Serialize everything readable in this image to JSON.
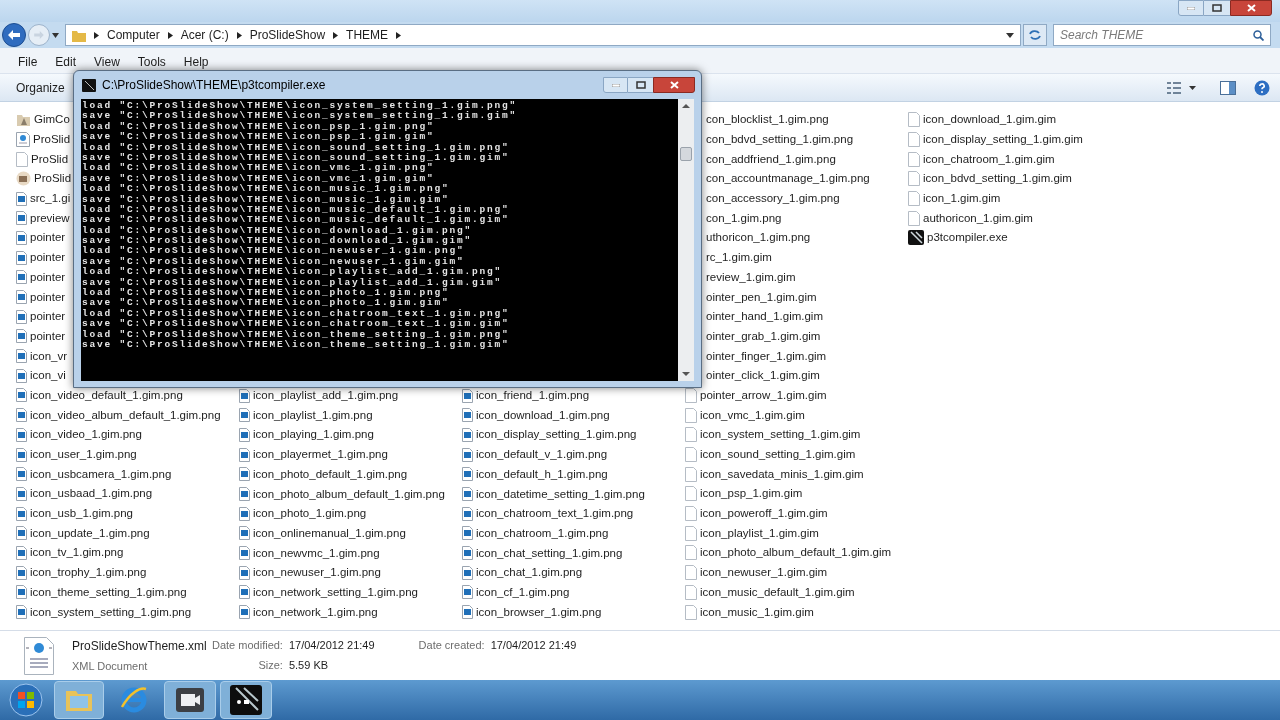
{
  "address_bar": {
    "crumbs": [
      "Computer",
      "Acer (C:)",
      "ProSlideShow",
      "THEME"
    ],
    "search": {
      "placeholder": "Search THEME"
    }
  },
  "menu": [
    "File",
    "Edit",
    "View",
    "Tools",
    "Help"
  ],
  "toolbar": {
    "organize": "Organize"
  },
  "file_columns": [
    {
      "under_window": false,
      "files": [
        {
          "name": "GimCo",
          "kind": "folder"
        },
        {
          "name": "ProSlid",
          "kind": "xml"
        },
        {
          "name": "ProSlid",
          "kind": "file"
        },
        {
          "name": "ProSlid",
          "kind": "app"
        },
        {
          "name": "src_1.gi",
          "kind": "png"
        },
        {
          "name": "preview",
          "kind": "png"
        },
        {
          "name": "pointer",
          "kind": "png"
        },
        {
          "name": "pointer",
          "kind": "png"
        },
        {
          "name": "pointer",
          "kind": "png"
        },
        {
          "name": "pointer",
          "kind": "png"
        },
        {
          "name": "pointer",
          "kind": "png"
        },
        {
          "name": "pointer",
          "kind": "png"
        },
        {
          "name": "icon_vr",
          "kind": "png"
        },
        {
          "name": "icon_vi",
          "kind": "png"
        },
        {
          "name": "icon_video_default_1.gim.png",
          "kind": "png"
        },
        {
          "name": "icon_video_album_default_1.gim.png",
          "kind": "png"
        },
        {
          "name": "icon_video_1.gim.png",
          "kind": "png"
        },
        {
          "name": "icon_user_1.gim.png",
          "kind": "png"
        },
        {
          "name": "icon_usbcamera_1.gim.png",
          "kind": "png"
        },
        {
          "name": "icon_usbaad_1.gim.png",
          "kind": "png"
        },
        {
          "name": "icon_usb_1.gim.png",
          "kind": "png"
        },
        {
          "name": "icon_update_1.gim.png",
          "kind": "png"
        },
        {
          "name": "icon_tv_1.gim.png",
          "kind": "png"
        },
        {
          "name": "icon_trophy_1.gim.png",
          "kind": "png"
        },
        {
          "name": "icon_theme_setting_1.gim.png",
          "kind": "png"
        },
        {
          "name": "icon_system_setting_1.gim.png",
          "kind": "png"
        }
      ]
    },
    {
      "under_window": true,
      "files": [
        {
          "name": "icon_playlist_add_1.gim.png",
          "kind": "png"
        },
        {
          "name": "icon_playlist_1.gim.png",
          "kind": "png"
        },
        {
          "name": "icon_playing_1.gim.png",
          "kind": "png"
        },
        {
          "name": "icon_playermet_1.gim.png",
          "kind": "png"
        },
        {
          "name": "icon_photo_default_1.gim.png",
          "kind": "png"
        },
        {
          "name": "icon_photo_album_default_1.gim.png",
          "kind": "png"
        },
        {
          "name": "icon_photo_1.gim.png",
          "kind": "png"
        },
        {
          "name": "icon_onlinemanual_1.gim.png",
          "kind": "png"
        },
        {
          "name": "icon_newvmc_1.gim.png",
          "kind": "png"
        },
        {
          "name": "icon_newuser_1.gim.png",
          "kind": "png"
        },
        {
          "name": "icon_network_setting_1.gim.png",
          "kind": "png"
        },
        {
          "name": "icon_network_1.gim.png",
          "kind": "png"
        }
      ]
    },
    {
      "under_window": true,
      "files": [
        {
          "name": "icon_friend_1.gim.png",
          "kind": "png"
        },
        {
          "name": "icon_download_1.gim.png",
          "kind": "png"
        },
        {
          "name": "icon_display_setting_1.gim.png",
          "kind": "png"
        },
        {
          "name": "icon_default_v_1.gim.png",
          "kind": "png"
        },
        {
          "name": "icon_default_h_1.gim.png",
          "kind": "png"
        },
        {
          "name": "icon_datetime_setting_1.gim.png",
          "kind": "png"
        },
        {
          "name": "icon_chatroom_text_1.gim.png",
          "kind": "png"
        },
        {
          "name": "icon_chatroom_1.gim.png",
          "kind": "png"
        },
        {
          "name": "icon_chat_setting_1.gim.png",
          "kind": "png"
        },
        {
          "name": "icon_chat_1.gim.png",
          "kind": "png"
        },
        {
          "name": "icon_cf_1.gim.png",
          "kind": "png"
        },
        {
          "name": "icon_browser_1.gim.png",
          "kind": "png"
        }
      ]
    },
    {
      "under_window": false,
      "files": [
        {
          "name": "con_blocklist_1.gim.png"
        },
        {
          "name": "con_bdvd_setting_1.gim.png"
        },
        {
          "name": "con_addfriend_1.gim.png"
        },
        {
          "name": "con_accountmanage_1.gim.png"
        },
        {
          "name": "con_accessory_1.gim.png"
        },
        {
          "name": "con_1.gim.png"
        },
        {
          "name": "uthoricon_1.gim.png"
        },
        {
          "name": "rc_1.gim.gim"
        },
        {
          "name": "review_1.gim.gim"
        },
        {
          "name": "ointer_pen_1.gim.gim"
        },
        {
          "name": "ointer_hand_1.gim.gim"
        },
        {
          "name": "ointer_grab_1.gim.gim"
        },
        {
          "name": "ointer_finger_1.gim.gim"
        },
        {
          "name": "ointer_click_1.gim.gim"
        },
        {
          "name": "pointer_arrow_1.gim.gim",
          "kind": "gim"
        },
        {
          "name": "icon_vmc_1.gim.gim",
          "kind": "gim"
        },
        {
          "name": "icon_system_setting_1.gim.gim",
          "kind": "gim"
        },
        {
          "name": "icon_sound_setting_1.gim.gim",
          "kind": "gim"
        },
        {
          "name": "icon_savedata_minis_1.gim.gim",
          "kind": "gim"
        },
        {
          "name": "icon_psp_1.gim.gim",
          "kind": "gim"
        },
        {
          "name": "icon_poweroff_1.gim.gim",
          "kind": "gim"
        },
        {
          "name": "icon_playlist_1.gim.gim",
          "kind": "gim"
        },
        {
          "name": "icon_photo_album_default_1.gim.gim",
          "kind": "gim"
        },
        {
          "name": "icon_newuser_1.gim.gim",
          "kind": "gim"
        },
        {
          "name": "icon_music_default_1.gim.gim",
          "kind": "gim"
        },
        {
          "name": "icon_music_1.gim.gim",
          "kind": "gim"
        }
      ]
    },
    {
      "under_window": false,
      "files": [
        {
          "name": "icon_download_1.gim.gim",
          "kind": "gim"
        },
        {
          "name": "icon_display_setting_1.gim.gim",
          "kind": "gim"
        },
        {
          "name": "icon_chatroom_1.gim.gim",
          "kind": "gim"
        },
        {
          "name": "icon_bdvd_setting_1.gim.gim",
          "kind": "gim"
        },
        {
          "name": "icon_1.gim.gim",
          "kind": "gim"
        },
        {
          "name": "authoricon_1.gim.gim",
          "kind": "gim"
        },
        {
          "name": "p3tcompiler.exe",
          "kind": "exe"
        }
      ]
    }
  ],
  "details": {
    "name": "ProSlideShowTheme.xml",
    "type": "XML Document",
    "fields": [
      {
        "label": "Date modified:",
        "value": "17/04/2012 21:49"
      },
      {
        "label": "Size:",
        "value": "5.59 KB"
      },
      {
        "label": "Date created:",
        "value": "17/04/2012 21:49"
      }
    ]
  },
  "console": {
    "title": "C:\\ProSlideShow\\THEME\\p3tcompiler.exe",
    "lines": [
      "load \"C:\\ProSlideShow\\THEME\\icon_system_setting_1.gim.png\"",
      "save \"C:\\ProSlideShow\\THEME\\icon_system_setting_1.gim.gim\"",
      "load \"C:\\ProSlideShow\\THEME\\icon_psp_1.gim.png\"",
      "save \"C:\\ProSlideShow\\THEME\\icon_psp_1.gim.gim\"",
      "load \"C:\\ProSlideShow\\THEME\\icon_sound_setting_1.gim.png\"",
      "save \"C:\\ProSlideShow\\THEME\\icon_sound_setting_1.gim.gim\"",
      "load \"C:\\ProSlideShow\\THEME\\icon_vmc_1.gim.png\"",
      "save \"C:\\ProSlideShow\\THEME\\icon_vmc_1.gim.gim\"",
      "load \"C:\\ProSlideShow\\THEME\\icon_music_1.gim.png\"",
      "save \"C:\\ProSlideShow\\THEME\\icon_music_1.gim.gim\"",
      "load \"C:\\ProSlideShow\\THEME\\icon_music_default_1.gim.png\"",
      "save \"C:\\ProSlideShow\\THEME\\icon_music_default_1.gim.gim\"",
      "load \"C:\\ProSlideShow\\THEME\\icon_download_1.gim.png\"",
      "save \"C:\\ProSlideShow\\THEME\\icon_download_1.gim.gim\"",
      "load \"C:\\ProSlideShow\\THEME\\icon_newuser_1.gim.png\"",
      "save \"C:\\ProSlideShow\\THEME\\icon_newuser_1.gim.gim\"",
      "load \"C:\\ProSlideShow\\THEME\\icon_playlist_add_1.gim.png\"",
      "save \"C:\\ProSlideShow\\THEME\\icon_playlist_add_1.gim.gim\"",
      "load \"C:\\ProSlideShow\\THEME\\icon_photo_1.gim.png\"",
      "save \"C:\\ProSlideShow\\THEME\\icon_photo_1.gim.gim\"",
      "load \"C:\\ProSlideShow\\THEME\\icon_chatroom_text_1.gim.png\"",
      "save \"C:\\ProSlideShow\\THEME\\icon_chatroom_text_1.gim.gim\"",
      "load \"C:\\ProSlideShow\\THEME\\icon_theme_setting_1.gim.png\"",
      "save \"C:\\ProSlideShow\\THEME\\icon_theme_setting_1.gim.gim\""
    ]
  },
  "taskbar": [
    {
      "kind": "start"
    },
    {
      "kind": "explorer"
    },
    {
      "kind": "browser"
    },
    {
      "kind": "video"
    },
    {
      "kind": "compiler"
    }
  ]
}
